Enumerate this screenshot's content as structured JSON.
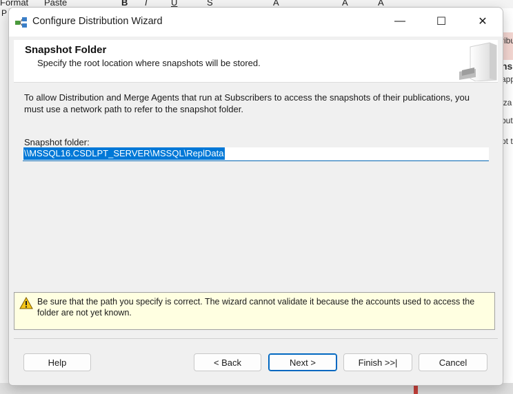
{
  "background_app": {
    "ribbon_items": [
      "Format",
      "Paste",
      "B",
      "I",
      "U",
      "S",
      "A",
      "A",
      "A"
    ],
    "ribbon_left_fragment": "P",
    "right_fragments": [
      "ribu",
      "ns",
      "app",
      "iza",
      "but",
      "pt t"
    ]
  },
  "window": {
    "title": "Configure Distribution Wizard",
    "controls": {
      "minimize": "—",
      "maximize": "☐",
      "close": "✕"
    }
  },
  "header": {
    "title": "Snapshot Folder",
    "subtitle": "Specify the root location where snapshots will be stored."
  },
  "body": {
    "description": "To allow Distribution and Merge Agents that run at Subscribers to access the snapshots of their publications, you must use a network path to refer to the snapshot folder.",
    "folder_label": "Snapshot folder:",
    "folder_value": "\\\\MSSQL16.CSDLPT_SERVER\\MSSQL\\ReplData"
  },
  "warning": {
    "icon": "warning-icon",
    "text": "Be sure that the path you specify is correct. The wizard cannot validate it because the accounts used to access the folder are not yet known."
  },
  "buttons": {
    "help": "Help",
    "back": "< Back",
    "next": "Next >",
    "finish": "Finish >>|",
    "cancel": "Cancel"
  },
  "colors": {
    "accent": "#0067c0",
    "selection": "#0078d7",
    "warning_bg": "#ffffe1"
  }
}
